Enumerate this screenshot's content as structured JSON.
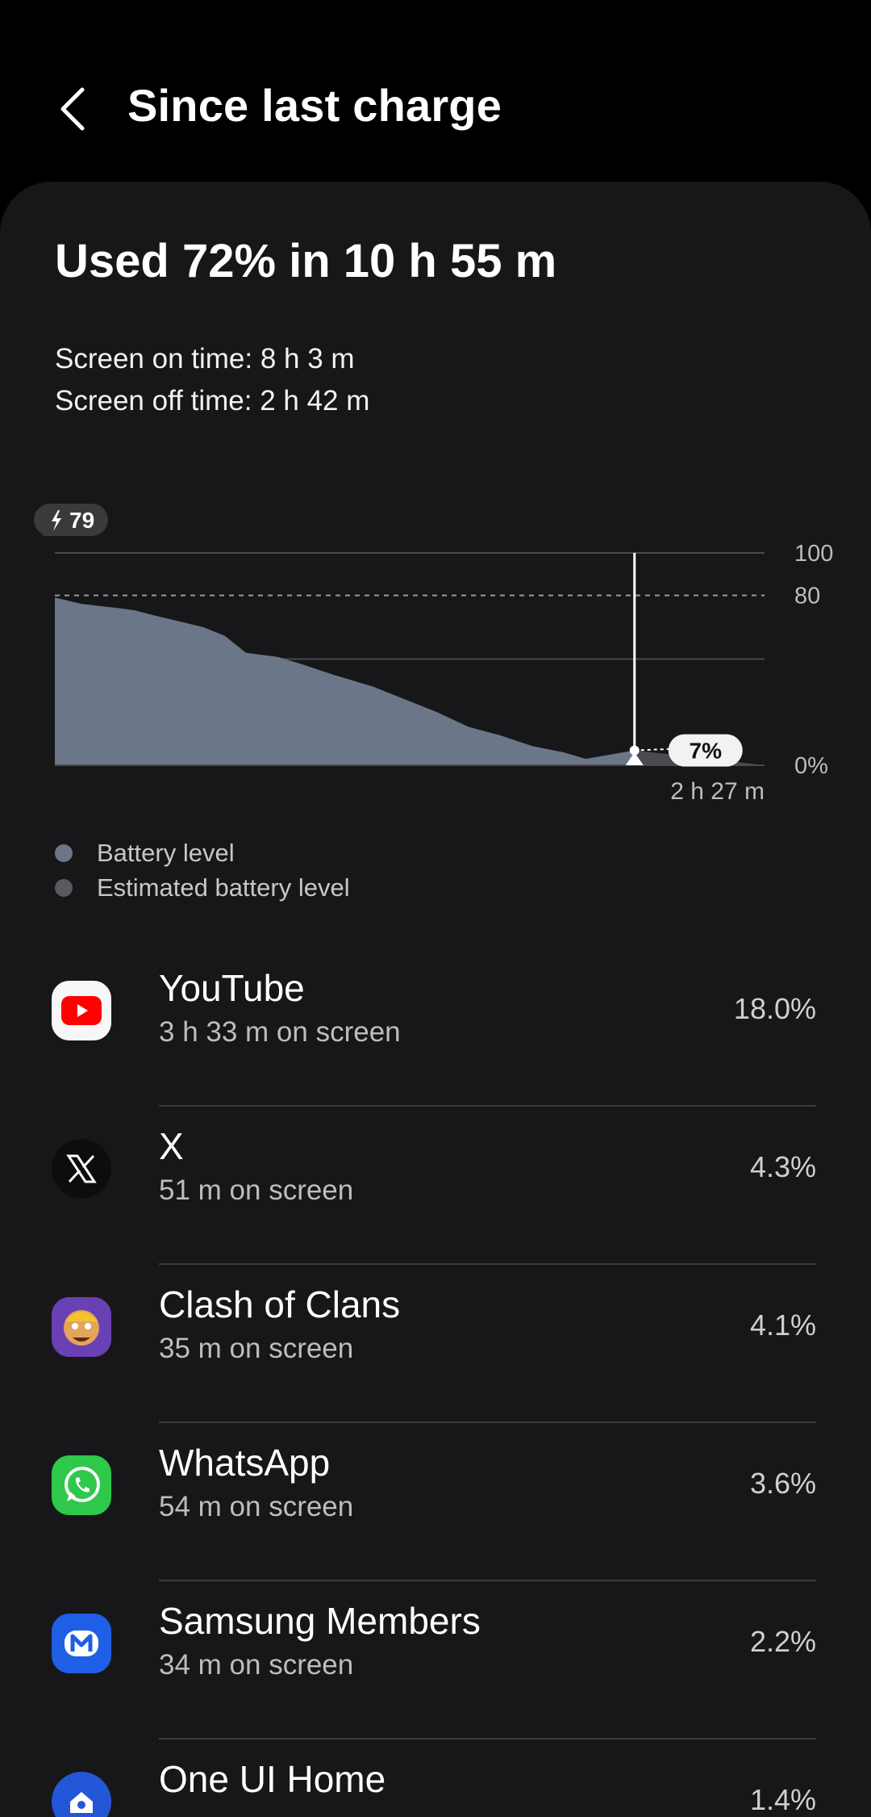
{
  "header": {
    "title": "Since last charge"
  },
  "summary": {
    "title": "Used 72% in 10 h 55 m",
    "screen_on": "Screen on time: 8 h 3 m",
    "screen_off": "Screen off time: 2 h 42 m"
  },
  "chart_data": {
    "type": "area",
    "title": "",
    "xlabel": "",
    "ylabel": "",
    "ylim": [
      0,
      100
    ],
    "y_ticks": [
      "100",
      "80",
      "0%"
    ],
    "charge_badge": "79",
    "reference_line": 80,
    "battery_level": [
      {
        "x": 0.0,
        "y": 79
      },
      {
        "x": 0.5,
        "y": 76
      },
      {
        "x": 1.2,
        "y": 74
      },
      {
        "x": 1.5,
        "y": 73
      },
      {
        "x": 1.8,
        "y": 71
      },
      {
        "x": 2.3,
        "y": 68
      },
      {
        "x": 2.8,
        "y": 65
      },
      {
        "x": 3.2,
        "y": 61
      },
      {
        "x": 3.6,
        "y": 53
      },
      {
        "x": 4.2,
        "y": 51
      },
      {
        "x": 4.6,
        "y": 48
      },
      {
        "x": 5.2,
        "y": 43
      },
      {
        "x": 6.0,
        "y": 37
      },
      {
        "x": 6.6,
        "y": 31
      },
      {
        "x": 7.2,
        "y": 25
      },
      {
        "x": 7.8,
        "y": 18
      },
      {
        "x": 8.4,
        "y": 14
      },
      {
        "x": 9.0,
        "y": 9
      },
      {
        "x": 9.6,
        "y": 6
      },
      {
        "x": 10.0,
        "y": 3
      },
      {
        "x": 10.92,
        "y": 7
      }
    ],
    "estimated_battery_level": [
      {
        "x": 10.92,
        "y": 7
      },
      {
        "x": 12.0,
        "y": 4
      },
      {
        "x": 13.37,
        "y": 0
      }
    ],
    "current_marker": {
      "value": "7%",
      "x": 10.92,
      "y": 7
    },
    "remaining_label": "2 h 27 m",
    "x_range": [
      0,
      13.37
    ],
    "legend": [
      {
        "label": "Battery level",
        "color": "#6b7689"
      },
      {
        "label": "Estimated battery level",
        "color": "#5a5a5e"
      }
    ],
    "colors": {
      "battery_fill": "#6b7689",
      "estimate_fill": "#4a4b4f",
      "grid": "#4a4a4d",
      "ref_line": "#9a9a9c"
    }
  },
  "apps": [
    {
      "name": "YouTube",
      "sub": "3 h 33 m on screen",
      "percent": "18.0%",
      "icon": "youtube-icon"
    },
    {
      "name": "X",
      "sub": "51 m on screen",
      "percent": "4.3%",
      "icon": "x-icon"
    },
    {
      "name": "Clash of Clans",
      "sub": "35 m on screen",
      "percent": "4.1%",
      "icon": "clash-of-clans-icon"
    },
    {
      "name": "WhatsApp",
      "sub": "54 m on screen",
      "percent": "3.6%",
      "icon": "whatsapp-icon"
    },
    {
      "name": "Samsung Members",
      "sub": "34 m on screen",
      "percent": "2.2%",
      "icon": "samsung-members-icon"
    },
    {
      "name": "One UI Home",
      "sub": "",
      "percent": "1.4%",
      "icon": "one-ui-home-icon"
    }
  ]
}
